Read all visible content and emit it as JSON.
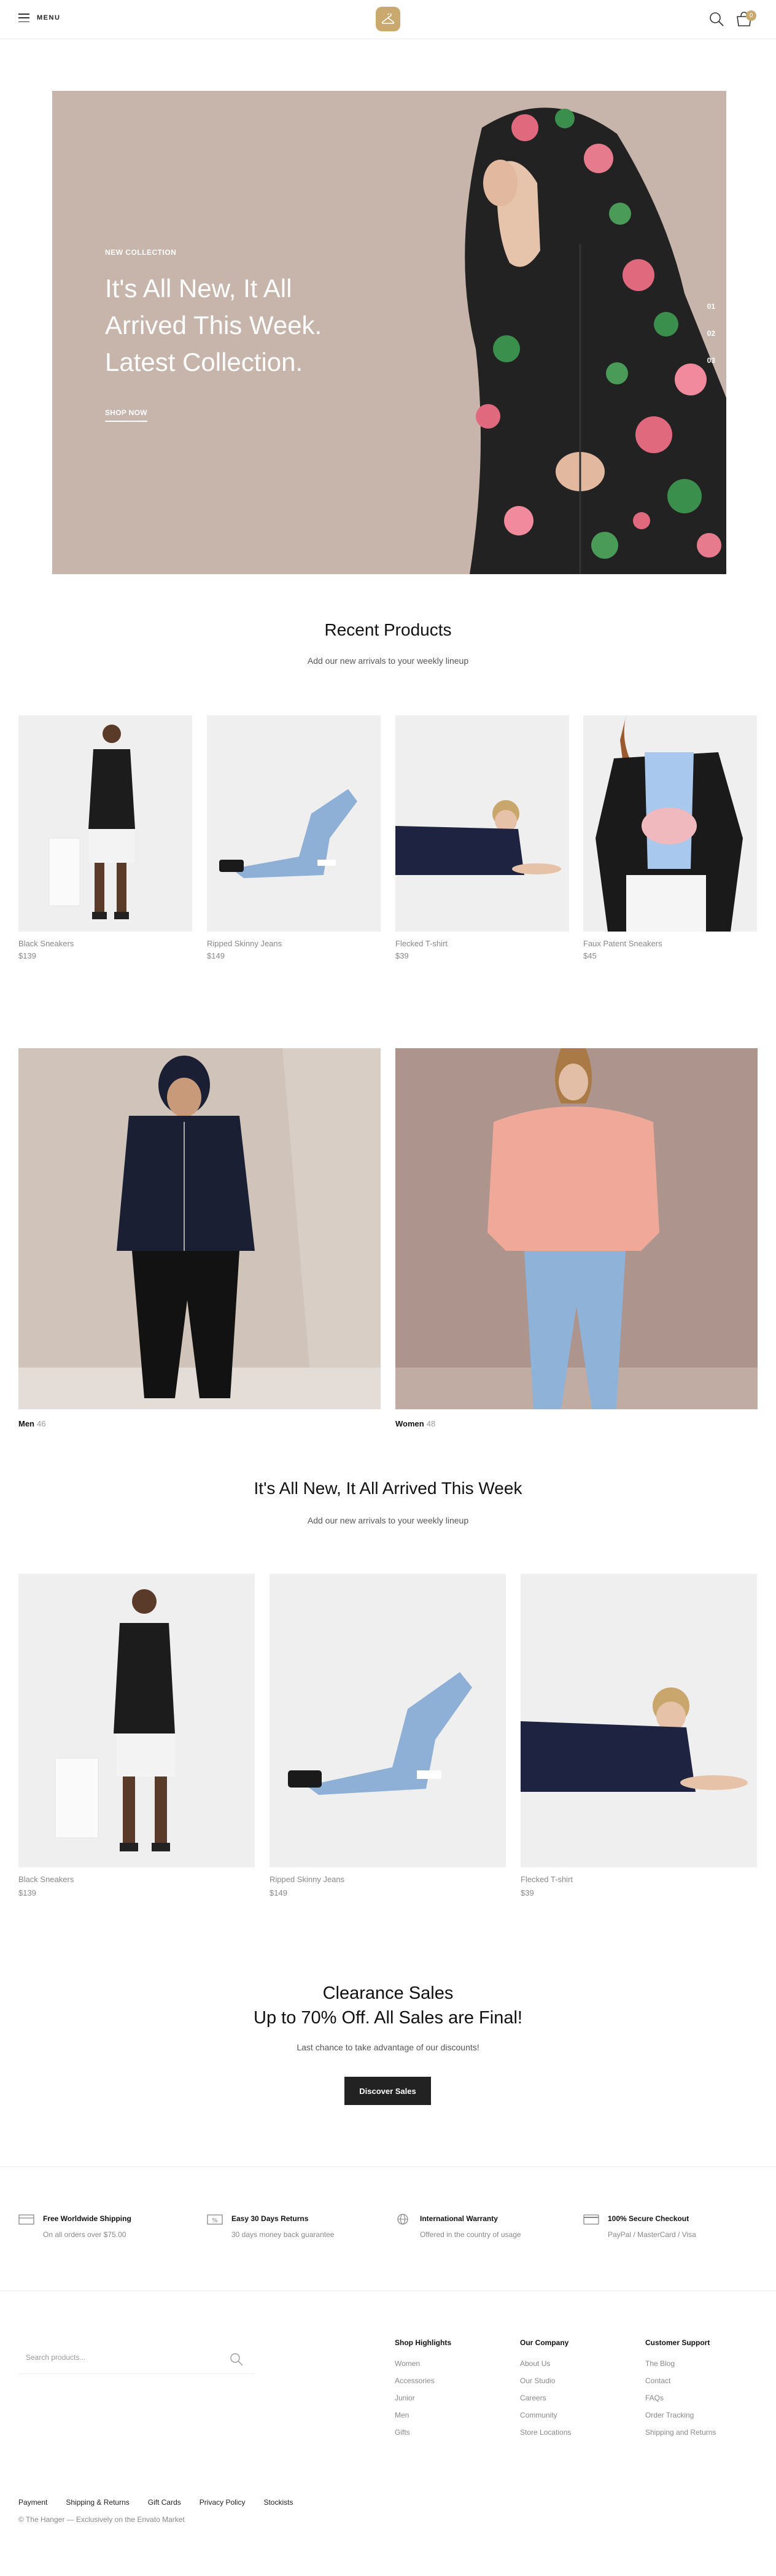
{
  "header": {
    "menu_label": "MENU",
    "cart_count": "0"
  },
  "hero": {
    "eyebrow": "NEW COLLECTION",
    "title": "It's All New, It All Arrived This Week. Latest Collection.",
    "cta": "SHOP NOW",
    "slides": [
      "01",
      "02",
      "03"
    ]
  },
  "recent": {
    "title": "Recent Products",
    "subtitle": "Add our new arrivals to your weekly lineup",
    "products": [
      {
        "name": "Black Sneakers",
        "price": "$139"
      },
      {
        "name": "Ripped Skinny Jeans",
        "price": "$149"
      },
      {
        "name": "Flecked T-shirt",
        "price": "$39"
      },
      {
        "name": "Faux Patent Sneakers",
        "price": "$45"
      }
    ]
  },
  "categories": [
    {
      "name": "Men",
      "count": "46"
    },
    {
      "name": "Women",
      "count": "48"
    }
  ],
  "arrived": {
    "title": "It's All New, It All Arrived This Week",
    "subtitle": "Add our new arrivals to your weekly lineup",
    "products": [
      {
        "name": "Black Sneakers",
        "price": "$139"
      },
      {
        "name": "Ripped Skinny Jeans",
        "price": "$149"
      },
      {
        "name": "Flecked T-shirt",
        "price": "$39"
      }
    ]
  },
  "clearance": {
    "title_line1": "Clearance Sales",
    "title_line2": "Up to 70% Off. All Sales are Final!",
    "subtitle": "Last chance to take advantage of our discounts!",
    "button": "Discover Sales"
  },
  "features": [
    {
      "icon": "truck-icon",
      "title": "Free Worldwide Shipping",
      "subtitle": "On all orders over $75.00"
    },
    {
      "icon": "percent-icon",
      "title": "Easy 30 Days Returns",
      "subtitle": "30 days money back guarantee"
    },
    {
      "icon": "globe-icon",
      "title": "International Warranty",
      "subtitle": "Offered in the country of usage"
    },
    {
      "icon": "credit-card-icon",
      "title": "100% Secure Checkout",
      "subtitle": "PayPal / MasterCard / Visa"
    }
  ],
  "footer": {
    "search_placeholder": "Search products...",
    "columns": [
      {
        "title": "Shop Highlights",
        "links": [
          "Women",
          "Accessories",
          "Junior",
          "Men",
          "Gifts"
        ]
      },
      {
        "title": "Our Company",
        "links": [
          "About Us",
          "Our Studio",
          "Careers",
          "Community",
          "Store Locations"
        ]
      },
      {
        "title": "Customer Support",
        "links": [
          "The Blog",
          "Contact",
          "FAQs",
          "Order Tracking",
          "Shipping and Returns"
        ]
      }
    ],
    "bottom_links": [
      "Payment",
      "Shipping & Returns",
      "Gift Cards",
      "Privacy Policy",
      "Stockists"
    ],
    "copyright": "© The Hanger — Exclusively on the Envato Market"
  },
  "colors": {
    "accent": "#c9a96e",
    "hero_bg": "#c7b4ab",
    "dark_button": "#222222"
  }
}
